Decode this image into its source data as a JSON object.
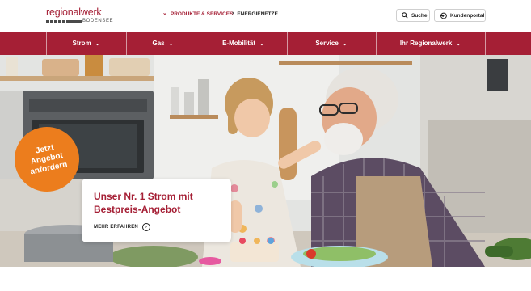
{
  "brand": {
    "name": "regionalwerk",
    "sub": "BODENSEE",
    "color": "#a51f35"
  },
  "topnav": {
    "produkte": "PRODUKTE & SERVICES",
    "energienetze": "ENERGIENETZE",
    "suche": "Suche",
    "kundenportal": "Kundenportal"
  },
  "mainnav": {
    "items": [
      {
        "label": "Strom"
      },
      {
        "label": "Gas"
      },
      {
        "label": "E-Mobilität"
      },
      {
        "label": "Service"
      },
      {
        "label": "Ihr Regionalwerk"
      }
    ]
  },
  "hero": {
    "badge": {
      "line1": "Jetzt",
      "line2": "Angebot",
      "line3": "anfordern",
      "color": "#ec7d1d"
    },
    "card": {
      "title": "Unser Nr. 1 Strom mit Bestpreis-Angebot",
      "link": "MEHR ERFAHREN"
    }
  }
}
